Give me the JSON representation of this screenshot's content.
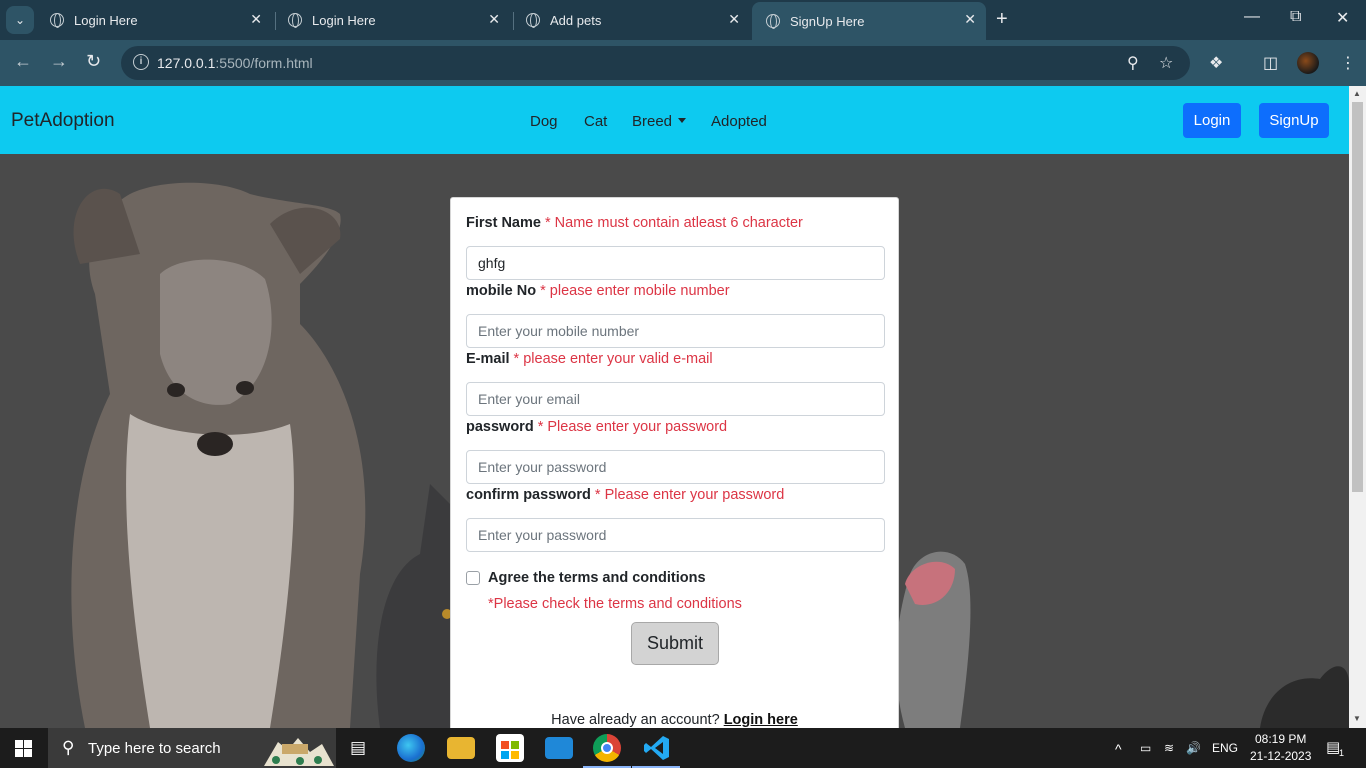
{
  "browser": {
    "tabs": [
      {
        "title": "Login Here",
        "active": false
      },
      {
        "title": "Login Here",
        "active": false
      },
      {
        "title": "Add pets",
        "active": false
      },
      {
        "title": "SignUp Here",
        "active": true
      }
    ],
    "url_host": "127.0.0.1",
    "url_rest": ":5500/form.html"
  },
  "navbar": {
    "brand": "PetAdoption",
    "links": [
      "Dog",
      "Cat",
      "Breed",
      "Adopted"
    ],
    "login": "Login",
    "signup": "SignUp",
    "color": "#0dcaf0"
  },
  "form": {
    "first_name": {
      "label": "First Name",
      "error": "* Name must contain atleast 6 character",
      "value": "ghfg"
    },
    "mobile": {
      "label": "mobile No",
      "error": "* please enter mobile number",
      "placeholder": "Enter your mobile number"
    },
    "email": {
      "label": "E-mail",
      "error": "* please enter your valid e-mail",
      "placeholder": "Enter your email"
    },
    "password": {
      "label": "password",
      "error": "* Please enter your password",
      "placeholder": "Enter your password"
    },
    "confirm": {
      "label": "confirm password",
      "error": "* Please enter your password",
      "placeholder": "Enter your password"
    },
    "terms_label": "Agree the terms and conditions",
    "terms_error": "*Please check the terms and conditions",
    "submit": "Submit",
    "have_account": "Have already an account?",
    "login_link": "Login here",
    "error_color": "#dc3545"
  },
  "taskbar": {
    "search_placeholder": "Type here to search",
    "language": "ENG",
    "time": "08:19 PM",
    "date": "21-12-2023",
    "notifications": "1"
  }
}
